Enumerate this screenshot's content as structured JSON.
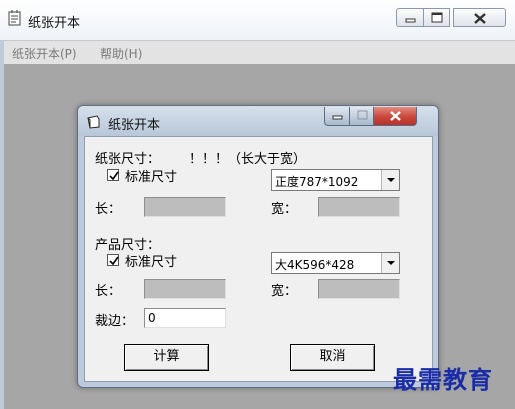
{
  "main_window": {
    "title": "纸张开本",
    "menu": [
      "纸张开本(P)",
      "帮助(H)"
    ]
  },
  "dialog": {
    "title": "纸张开本",
    "paper_size_label": "纸张尺寸：",
    "paper_size_hint": "！！！（长大于宽）",
    "paper_standard_checkbox": {
      "label": "标准尺寸",
      "checked": true
    },
    "paper_standard_select": "正度787*1092",
    "paper_length_label": "长：",
    "paper_length_value": "",
    "paper_width_label": "宽：",
    "paper_width_value": "",
    "product_size_label": "产品尺寸：",
    "product_standard_checkbox": {
      "label": "标准尺寸",
      "checked": true
    },
    "product_standard_select": "大4K596*428",
    "product_length_label": "长：",
    "product_length_value": "",
    "product_width_label": "宽：",
    "product_width_value": "",
    "trim_label": "裁边：",
    "trim_value": "0",
    "calculate_button": "计算",
    "cancel_button": "取消"
  },
  "watermark": "最需教育",
  "colors": {
    "dialog_frame": "#bccadb",
    "close_button": "#c9463d",
    "watermark": "#1a2ca8"
  }
}
